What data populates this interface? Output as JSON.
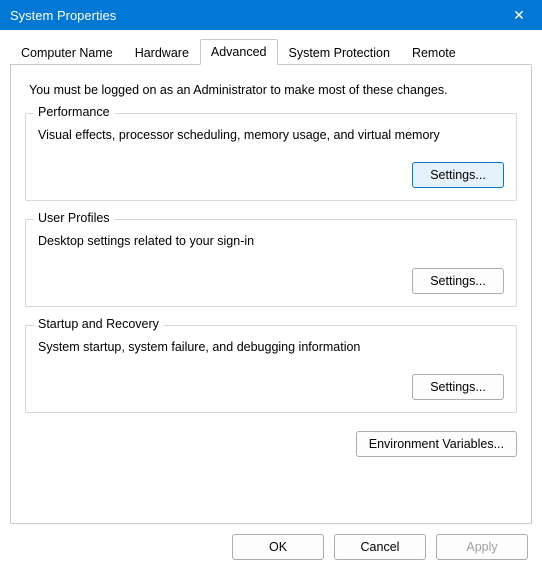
{
  "window": {
    "title": "System Properties",
    "close_label": "✕"
  },
  "tabs": {
    "computerName": "Computer Name",
    "hardware": "Hardware",
    "advanced": "Advanced",
    "systemProtection": "System Protection",
    "remote": "Remote"
  },
  "advanced": {
    "admin_note": "You must be logged on as an Administrator to make most of these changes.",
    "performance": {
      "title": "Performance",
      "desc": "Visual effects, processor scheduling, memory usage, and virtual memory",
      "button": "Settings..."
    },
    "userProfiles": {
      "title": "User Profiles",
      "desc": "Desktop settings related to your sign-in",
      "button": "Settings..."
    },
    "startupRecovery": {
      "title": "Startup and Recovery",
      "desc": "System startup, system failure, and debugging information",
      "button": "Settings..."
    },
    "envVars": "Environment Variables..."
  },
  "buttons": {
    "ok": "OK",
    "cancel": "Cancel",
    "apply": "Apply"
  }
}
